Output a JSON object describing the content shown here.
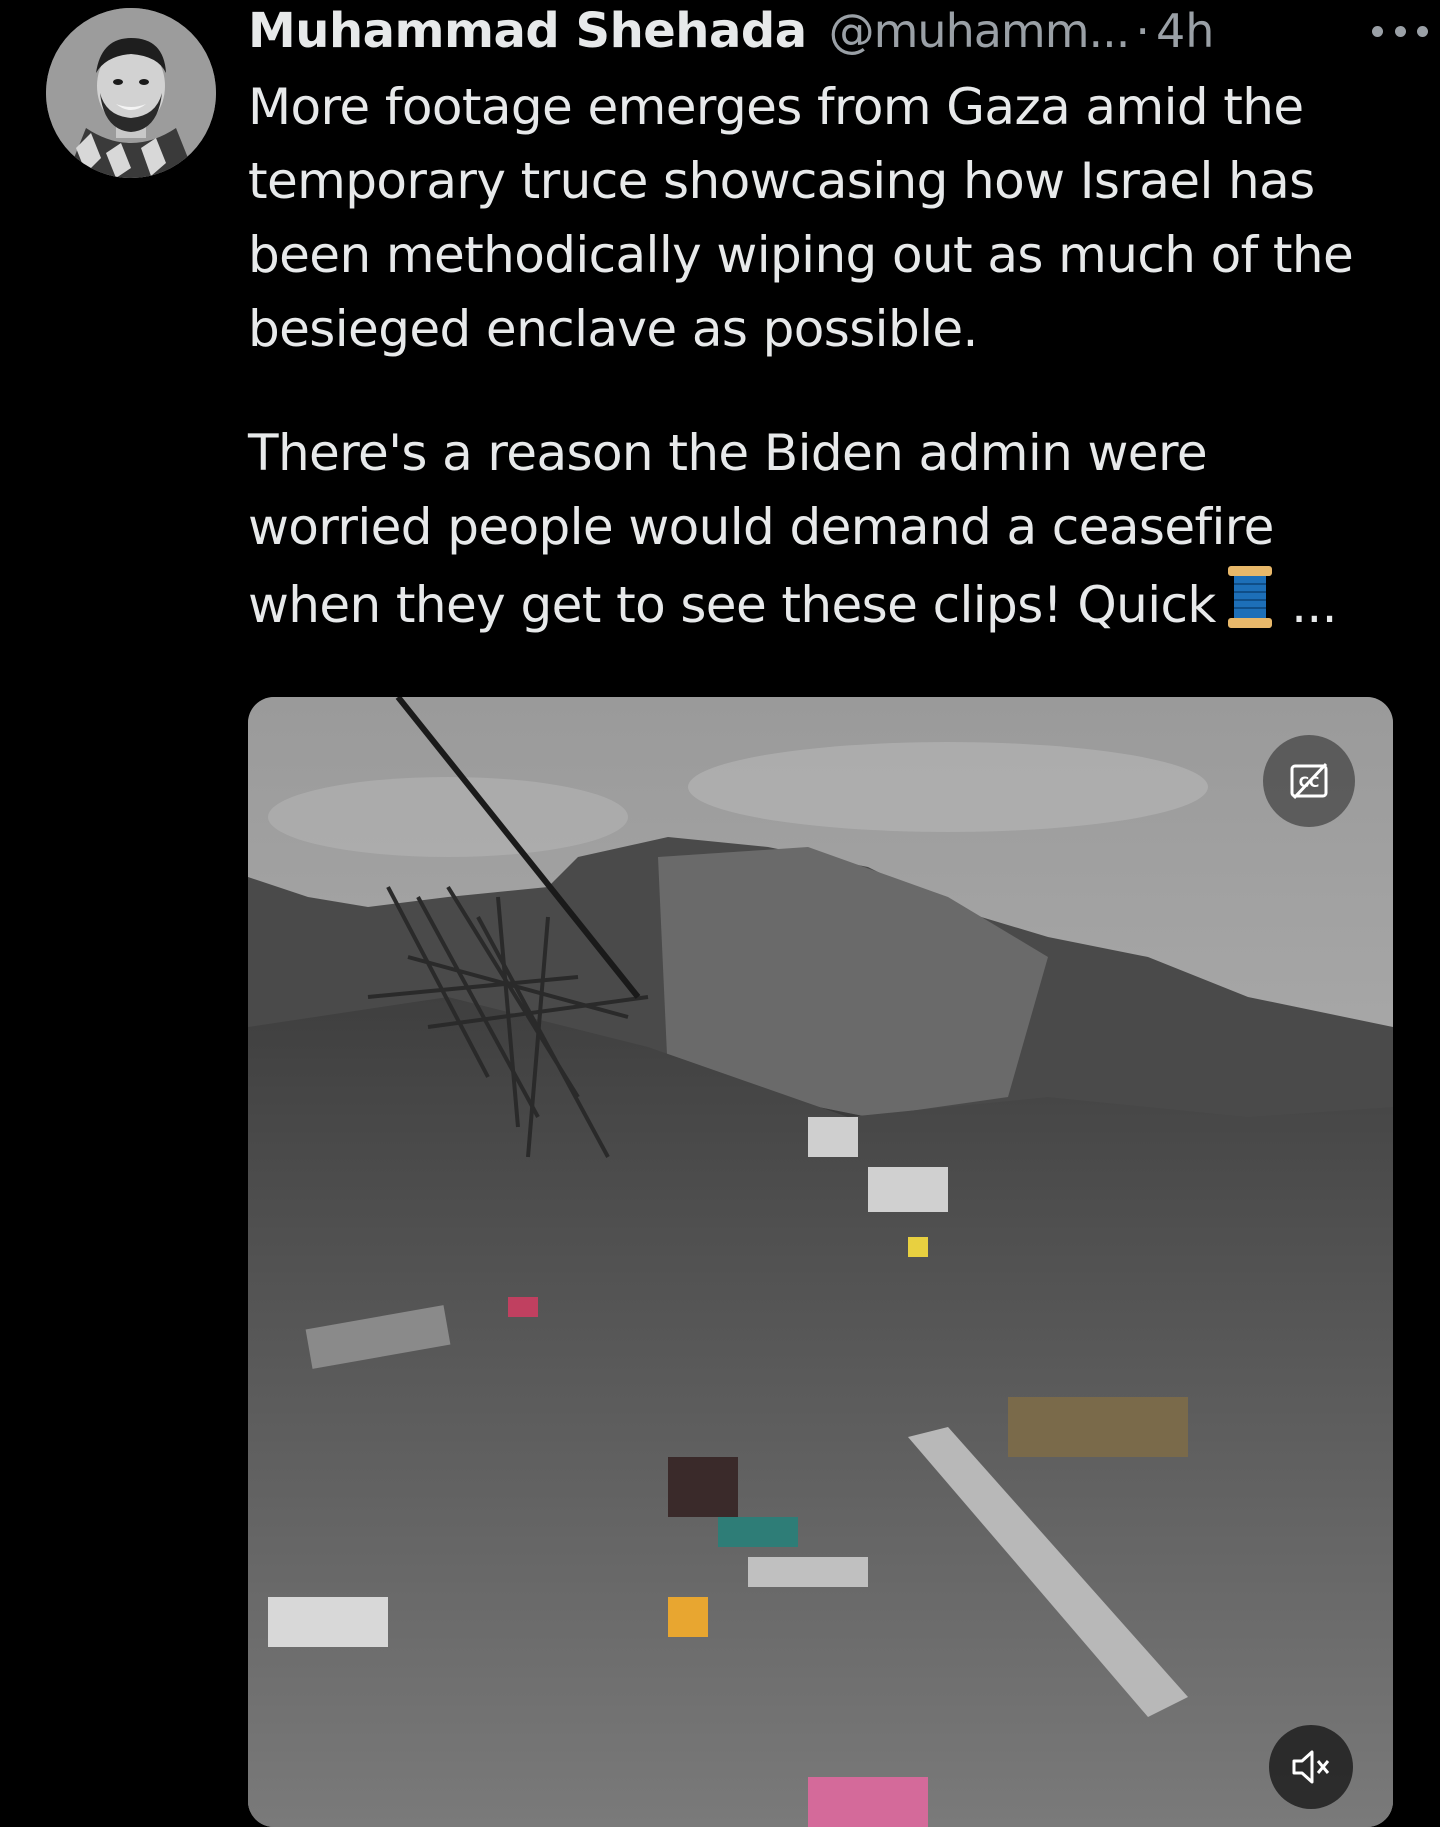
{
  "tweet": {
    "display_name": "Muhammad Shehada",
    "handle": "@muhamm...",
    "separator": "·",
    "time": "4h",
    "paragraph_1": "More footage emerges from Gaza amid the temporary truce showcasing how Israel has been methodically wiping out as much of the besieged enclave as possible.",
    "paragraph_2": "There's a reason the Biden admin were worried people would demand a ceasefire when they get to see these clips! Quick",
    "truncation": "...",
    "thread_emoji": "spool-of-thread-icon"
  },
  "media": {
    "type": "video",
    "cc_icon": "closed-captions-off-icon",
    "mute_icon": "speaker-muted-icon"
  },
  "colors": {
    "background": "#000000",
    "text_primary": "#e7e9ea",
    "text_secondary": "#9aa0a6",
    "accent_thread": "#1d9bf0"
  }
}
